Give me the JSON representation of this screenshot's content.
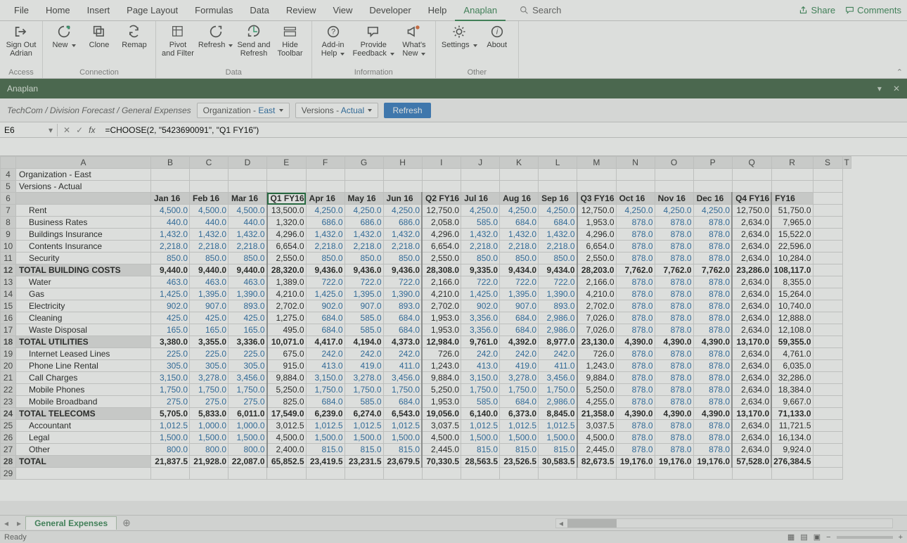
{
  "menu": {
    "tabs": [
      "File",
      "Home",
      "Insert",
      "Page Layout",
      "Formulas",
      "Data",
      "Review",
      "View",
      "Developer",
      "Help",
      "Anaplan"
    ],
    "active": 10,
    "search": "Search",
    "share": "Share",
    "comments": "Comments"
  },
  "ribbon": {
    "groups": [
      {
        "label": "Access",
        "btns": [
          {
            "t": "Sign Out\nAdrian",
            "icon": "signout"
          }
        ]
      },
      {
        "label": "Connection",
        "btns": [
          {
            "t": "New",
            "icon": "new",
            "dd": true
          },
          {
            "t": "Clone",
            "icon": "clone"
          },
          {
            "t": "Remap",
            "icon": "remap"
          }
        ]
      },
      {
        "label": "Data",
        "btns": [
          {
            "t": "Pivot\nand Filter",
            "icon": "pivot"
          },
          {
            "t": "Refresh",
            "icon": "refresh",
            "dd": true
          },
          {
            "t": "Send and\nRefresh",
            "icon": "send"
          },
          {
            "t": "Hide\nToolbar",
            "icon": "toolbar"
          }
        ]
      },
      {
        "label": "Information",
        "btns": [
          {
            "t": "Add-in\nHelp",
            "icon": "help",
            "dd": true
          },
          {
            "t": "Provide\nFeedback",
            "icon": "feedback",
            "dd": true
          },
          {
            "t": "What's\nNew",
            "icon": "whatsnew",
            "dd": true
          }
        ]
      },
      {
        "label": "Other",
        "btns": [
          {
            "t": "Settings",
            "icon": "settings",
            "dd": true
          },
          {
            "t": "About",
            "icon": "about"
          }
        ]
      }
    ]
  },
  "context": {
    "title": "Anaplan"
  },
  "crumbs": {
    "path": "TechCom / Division Forecast / General Expenses",
    "org_lbl": "Organization - ",
    "org_val": "East",
    "ver_lbl": "Versions - ",
    "ver_val": "Actual",
    "refresh": "Refresh"
  },
  "formula": {
    "cell": "E6",
    "text": "=CHOOSE(2, \"5423690091\", \"Q1 FY16\")"
  },
  "sheet_tab": "General Expenses",
  "status": "Ready",
  "cols": [
    "A",
    "B",
    "C",
    "D",
    "E",
    "F",
    "G",
    "H",
    "I",
    "J",
    "K",
    "L",
    "M",
    "N",
    "O",
    "P",
    "Q",
    "R",
    "S",
    "T"
  ],
  "grid": {
    "org": "Organization - East",
    "ver": "Versions - Actual",
    "headers": [
      "Jan 16",
      "Feb 16",
      "Mar 16",
      "Q1 FY16",
      "Apr 16",
      "May 16",
      "Jun 16",
      "Q2 FY16",
      "Jul 16",
      "Aug 16",
      "Sep 16",
      "Q3 FY16",
      "Oct 16",
      "Nov 16",
      "Dec 16",
      "Q4 FY16",
      "FY16"
    ],
    "rows": [
      {
        "n": 7,
        "lbl": "Rent",
        "ind": 1,
        "v": [
          "4,500.0",
          "4,500.0",
          "4,500.0",
          "13,500.0",
          "4,250.0",
          "4,250.0",
          "4,250.0",
          "12,750.0",
          "4,250.0",
          "4,250.0",
          "4,250.0",
          "12,750.0",
          "4,250.0",
          "4,250.0",
          "4,250.0",
          "12,750.0",
          "51,750.0"
        ]
      },
      {
        "n": 8,
        "lbl": "Business Rates",
        "ind": 1,
        "v": [
          "440.0",
          "440.0",
          "440.0",
          "1,320.0",
          "686.0",
          "686.0",
          "686.0",
          "2,058.0",
          "585.0",
          "684.0",
          "684.0",
          "1,953.0",
          "878.0",
          "878.0",
          "878.0",
          "2,634.0",
          "7,965.0"
        ]
      },
      {
        "n": 9,
        "lbl": "Buildings Insurance",
        "ind": 1,
        "v": [
          "1,432.0",
          "1,432.0",
          "1,432.0",
          "4,296.0",
          "1,432.0",
          "1,432.0",
          "1,432.0",
          "4,296.0",
          "1,432.0",
          "1,432.0",
          "1,432.0",
          "4,296.0",
          "878.0",
          "878.0",
          "878.0",
          "2,634.0",
          "15,522.0"
        ]
      },
      {
        "n": 10,
        "lbl": "Contents Insurance",
        "ind": 1,
        "v": [
          "2,218.0",
          "2,218.0",
          "2,218.0",
          "6,654.0",
          "2,218.0",
          "2,218.0",
          "2,218.0",
          "6,654.0",
          "2,218.0",
          "2,218.0",
          "2,218.0",
          "6,654.0",
          "878.0",
          "878.0",
          "878.0",
          "2,634.0",
          "22,596.0"
        ]
      },
      {
        "n": 11,
        "lbl": "Security",
        "ind": 1,
        "v": [
          "850.0",
          "850.0",
          "850.0",
          "2,550.0",
          "850.0",
          "850.0",
          "850.0",
          "2,550.0",
          "850.0",
          "850.0",
          "850.0",
          "2,550.0",
          "878.0",
          "878.0",
          "878.0",
          "2,634.0",
          "10,284.0"
        ]
      },
      {
        "n": 12,
        "lbl": "TOTAL BUILDING COSTS",
        "sec": 1,
        "v": [
          "9,440.0",
          "9,440.0",
          "9,440.0",
          "28,320.0",
          "9,436.0",
          "9,436.0",
          "9,436.0",
          "28,308.0",
          "9,335.0",
          "9,434.0",
          "9,434.0",
          "28,203.0",
          "7,762.0",
          "7,762.0",
          "7,762.0",
          "23,286.0",
          "108,117.0"
        ]
      },
      {
        "n": 13,
        "lbl": "Water",
        "ind": 1,
        "v": [
          "463.0",
          "463.0",
          "463.0",
          "1,389.0",
          "722.0",
          "722.0",
          "722.0",
          "2,166.0",
          "722.0",
          "722.0",
          "722.0",
          "2,166.0",
          "878.0",
          "878.0",
          "878.0",
          "2,634.0",
          "8,355.0"
        ]
      },
      {
        "n": 14,
        "lbl": "Gas",
        "ind": 1,
        "v": [
          "1,425.0",
          "1,395.0",
          "1,390.0",
          "4,210.0",
          "1,425.0",
          "1,395.0",
          "1,390.0",
          "4,210.0",
          "1,425.0",
          "1,395.0",
          "1,390.0",
          "4,210.0",
          "878.0",
          "878.0",
          "878.0",
          "2,634.0",
          "15,264.0"
        ]
      },
      {
        "n": 15,
        "lbl": "Electricity",
        "ind": 1,
        "v": [
          "902.0",
          "907.0",
          "893.0",
          "2,702.0",
          "902.0",
          "907.0",
          "893.0",
          "2,702.0",
          "902.0",
          "907.0",
          "893.0",
          "2,702.0",
          "878.0",
          "878.0",
          "878.0",
          "2,634.0",
          "10,740.0"
        ]
      },
      {
        "n": 16,
        "lbl": "Cleaning",
        "ind": 1,
        "v": [
          "425.0",
          "425.0",
          "425.0",
          "1,275.0",
          "684.0",
          "585.0",
          "684.0",
          "1,953.0",
          "3,356.0",
          "684.0",
          "2,986.0",
          "7,026.0",
          "878.0",
          "878.0",
          "878.0",
          "2,634.0",
          "12,888.0"
        ]
      },
      {
        "n": 17,
        "lbl": "Waste Disposal",
        "ind": 1,
        "v": [
          "165.0",
          "165.0",
          "165.0",
          "495.0",
          "684.0",
          "585.0",
          "684.0",
          "1,953.0",
          "3,356.0",
          "684.0",
          "2,986.0",
          "7,026.0",
          "878.0",
          "878.0",
          "878.0",
          "2,634.0",
          "12,108.0"
        ]
      },
      {
        "n": 18,
        "lbl": "TOTAL UTILITIES",
        "sec": 1,
        "v": [
          "3,380.0",
          "3,355.0",
          "3,336.0",
          "10,071.0",
          "4,417.0",
          "4,194.0",
          "4,373.0",
          "12,984.0",
          "9,761.0",
          "4,392.0",
          "8,977.0",
          "23,130.0",
          "4,390.0",
          "4,390.0",
          "4,390.0",
          "13,170.0",
          "59,355.0"
        ]
      },
      {
        "n": 19,
        "lbl": "Internet Leased Lines",
        "ind": 1,
        "v": [
          "225.0",
          "225.0",
          "225.0",
          "675.0",
          "242.0",
          "242.0",
          "242.0",
          "726.0",
          "242.0",
          "242.0",
          "242.0",
          "726.0",
          "878.0",
          "878.0",
          "878.0",
          "2,634.0",
          "4,761.0"
        ]
      },
      {
        "n": 20,
        "lbl": "Phone Line Rental",
        "ind": 1,
        "v": [
          "305.0",
          "305.0",
          "305.0",
          "915.0",
          "413.0",
          "419.0",
          "411.0",
          "1,243.0",
          "413.0",
          "419.0",
          "411.0",
          "1,243.0",
          "878.0",
          "878.0",
          "878.0",
          "2,634.0",
          "6,035.0"
        ]
      },
      {
        "n": 21,
        "lbl": "Call Charges",
        "ind": 1,
        "v": [
          "3,150.0",
          "3,278.0",
          "3,456.0",
          "9,884.0",
          "3,150.0",
          "3,278.0",
          "3,456.0",
          "9,884.0",
          "3,150.0",
          "3,278.0",
          "3,456.0",
          "9,884.0",
          "878.0",
          "878.0",
          "878.0",
          "2,634.0",
          "32,286.0"
        ]
      },
      {
        "n": 22,
        "lbl": "Mobile Phones",
        "ind": 1,
        "v": [
          "1,750.0",
          "1,750.0",
          "1,750.0",
          "5,250.0",
          "1,750.0",
          "1,750.0",
          "1,750.0",
          "5,250.0",
          "1,750.0",
          "1,750.0",
          "1,750.0",
          "5,250.0",
          "878.0",
          "878.0",
          "878.0",
          "2,634.0",
          "18,384.0"
        ]
      },
      {
        "n": 23,
        "lbl": "Mobile Broadband",
        "ind": 1,
        "v": [
          "275.0",
          "275.0",
          "275.0",
          "825.0",
          "684.0",
          "585.0",
          "684.0",
          "1,953.0",
          "585.0",
          "684.0",
          "2,986.0",
          "4,255.0",
          "878.0",
          "878.0",
          "878.0",
          "2,634.0",
          "9,667.0"
        ]
      },
      {
        "n": 24,
        "lbl": "TOTAL TELECOMS",
        "sec": 1,
        "v": [
          "5,705.0",
          "5,833.0",
          "6,011.0",
          "17,549.0",
          "6,239.0",
          "6,274.0",
          "6,543.0",
          "19,056.0",
          "6,140.0",
          "6,373.0",
          "8,845.0",
          "21,358.0",
          "4,390.0",
          "4,390.0",
          "4,390.0",
          "13,170.0",
          "71,133.0"
        ]
      },
      {
        "n": 25,
        "lbl": "Accountant",
        "ind": 1,
        "v": [
          "1,012.5",
          "1,000.0",
          "1,000.0",
          "3,012.5",
          "1,012.5",
          "1,012.5",
          "1,012.5",
          "3,037.5",
          "1,012.5",
          "1,012.5",
          "1,012.5",
          "3,037.5",
          "878.0",
          "878.0",
          "878.0",
          "2,634.0",
          "11,721.5"
        ]
      },
      {
        "n": 26,
        "lbl": "Legal",
        "ind": 1,
        "v": [
          "1,500.0",
          "1,500.0",
          "1,500.0",
          "4,500.0",
          "1,500.0",
          "1,500.0",
          "1,500.0",
          "4,500.0",
          "1,500.0",
          "1,500.0",
          "1,500.0",
          "4,500.0",
          "878.0",
          "878.0",
          "878.0",
          "2,634.0",
          "16,134.0"
        ]
      },
      {
        "n": 27,
        "lbl": "Other",
        "ind": 1,
        "v": [
          "800.0",
          "800.0",
          "800.0",
          "2,400.0",
          "815.0",
          "815.0",
          "815.0",
          "2,445.0",
          "815.0",
          "815.0",
          "815.0",
          "2,445.0",
          "878.0",
          "878.0",
          "878.0",
          "2,634.0",
          "9,924.0"
        ]
      },
      {
        "n": 28,
        "lbl": "TOTAL",
        "sec": 1,
        "v": [
          "21,837.5",
          "21,928.0",
          "22,087.0",
          "65,852.5",
          "23,419.5",
          "23,231.5",
          "23,679.5",
          "70,330.5",
          "28,563.5",
          "23,526.5",
          "30,583.5",
          "82,673.5",
          "19,176.0",
          "19,176.0",
          "19,176.0",
          "57,528.0",
          "276,384.5"
        ]
      }
    ]
  },
  "colors": {
    "accent": "#3f8a5c",
    "link_blue": "#2b6ea8"
  }
}
